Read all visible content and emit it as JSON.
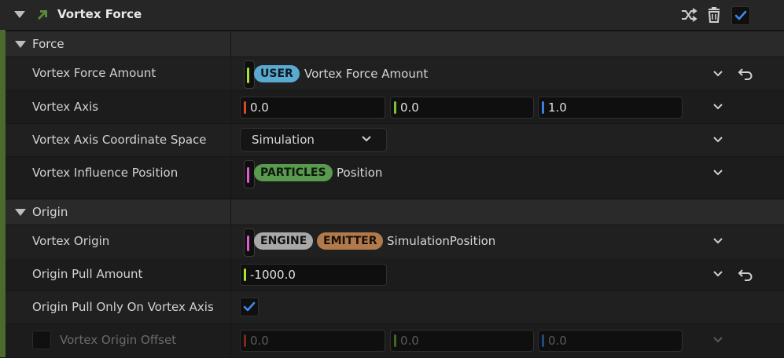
{
  "module": {
    "title": "Vortex Force",
    "icon": "module-arrow-icon",
    "enabled": true,
    "accent": "#3c8af0",
    "strip_color": "#4c6a2e"
  },
  "categories": {
    "force": "Force",
    "origin": "Origin"
  },
  "rows": {
    "vortex_force_amount": {
      "label": "Vortex Force Amount",
      "namespace": "USER",
      "param": "Vortex Force Amount",
      "link_color": "#a6e22e"
    },
    "vortex_axis": {
      "label": "Vortex Axis",
      "x": "0.0",
      "y": "0.0",
      "z": "1.0"
    },
    "vortex_axis_space": {
      "label": "Vortex Axis Coordinate Space",
      "value": "Simulation"
    },
    "vortex_influence_position": {
      "label": "Vortex Influence Position",
      "namespace": "PARTICLES",
      "param": "Position",
      "link_color": "#e05ad8"
    },
    "vortex_origin": {
      "label": "Vortex Origin",
      "namespace1": "ENGINE",
      "namespace2": "EMITTER",
      "param": "SimulationPosition",
      "link_color": "#e05ad8"
    },
    "origin_pull_amount": {
      "label": "Origin Pull Amount",
      "value": "-1000.0"
    },
    "origin_pull_only_on_axis": {
      "label": "Origin Pull Only On Vortex Axis",
      "checked": true
    },
    "vortex_origin_offset": {
      "label": "Vortex Origin Offset",
      "enabled": false,
      "x": "0.0",
      "y": "0.0",
      "z": "0.0"
    }
  },
  "colors": {
    "axis_x": "#d84a2a",
    "axis_y": "#79c23a",
    "axis_z": "#3d7fe0",
    "float_bar": "#a6e22e"
  }
}
